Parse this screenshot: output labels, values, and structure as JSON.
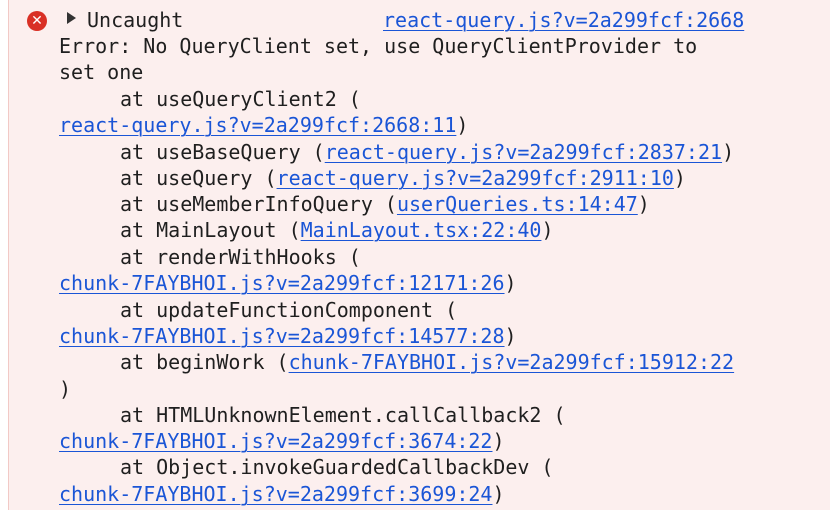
{
  "colors": {
    "background": "#fcefee",
    "link": "#1a55d6",
    "error_icon": "#d93025",
    "text": "#1f1f1f"
  },
  "icons": {
    "error": "error-circle-x-icon",
    "expand": "disclosure-triangle-icon"
  },
  "header": {
    "status": "Uncaught",
    "source_link": "react-query.js?v=2a299fcf:2668"
  },
  "error": {
    "message_line1": "Error: No QueryClient set, use QueryClientProvider to",
    "message_line2": "set one"
  },
  "stack": [
    {
      "prefix": "at useQueryClient2 (",
      "link": "react-query.js?v=2a299fcf:2668:11",
      "suffix": ")"
    },
    {
      "prefix": "at useBaseQuery (",
      "link": "react-query.js?v=2a299fcf:2837:21",
      "suffix": ")"
    },
    {
      "prefix": "at useQuery (",
      "link": "react-query.js?v=2a299fcf:2911:10",
      "suffix": ")"
    },
    {
      "prefix": "at useMemberInfoQuery (",
      "link": "userQueries.ts:14:47",
      "suffix": ")"
    },
    {
      "prefix": "at MainLayout (",
      "link": "MainLayout.tsx:22:40",
      "suffix": ")"
    },
    {
      "prefix": "at renderWithHooks (",
      "link": "chunk-7FAYBHOI.js?v=2a299fcf:12171:26",
      "suffix": ")"
    },
    {
      "prefix": "at updateFunctionComponent (",
      "link": "chunk-7FAYBHOI.js?v=2a299fcf:14577:28",
      "suffix": ")"
    },
    {
      "prefix": "at beginWork (",
      "link": "chunk-7FAYBHOI.js?v=2a299fcf:15912:22",
      "suffix": ")"
    },
    {
      "prefix": "at HTMLUnknownElement.callCallback2 (",
      "link": "chunk-7FAYBHOI.js?v=2a299fcf:3674:22",
      "suffix": ")"
    },
    {
      "prefix": "at Object.invokeGuardedCallbackDev (",
      "link": "chunk-7FAYBHOI.js?v=2a299fcf:3699:24",
      "suffix": ")"
    }
  ]
}
